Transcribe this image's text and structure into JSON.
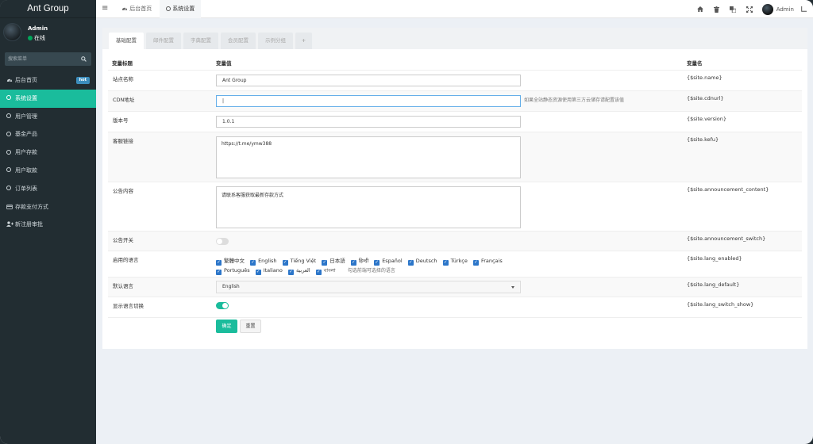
{
  "brand": "Ant Group",
  "user": {
    "name": "Admin",
    "status": "在线"
  },
  "search": {
    "placeholder": "搜索菜单"
  },
  "menu": [
    {
      "label": "后台首页",
      "icon": "dashboard-icon",
      "badge": "hot"
    },
    {
      "label": "系统设置",
      "icon": "circle-icon",
      "active": true
    },
    {
      "label": "用户管理",
      "icon": "circle-icon"
    },
    {
      "label": "基金产品",
      "icon": "circle-icon"
    },
    {
      "label": "用户存款",
      "icon": "circle-icon"
    },
    {
      "label": "用户取款",
      "icon": "circle-icon"
    },
    {
      "label": "订单列表",
      "icon": "circle-icon"
    },
    {
      "label": "存款支付方式",
      "icon": "credit-card-icon"
    },
    {
      "label": "新注册审批",
      "icon": "user-plus-icon"
    }
  ],
  "topbar": {
    "tabs": [
      {
        "label": "后台首页",
        "icon": "dashboard-icon"
      },
      {
        "label": "系统设置",
        "icon": "circle-icon",
        "active": true
      }
    ],
    "username": "Admin",
    "icons": [
      "home-icon",
      "trash-icon",
      "translate-icon",
      "fullscreen-icon"
    ]
  },
  "config_tabs": [
    "基础配置",
    "邮件配置",
    "字典配置",
    "会员配置",
    "示例分组",
    "+"
  ],
  "table": {
    "headers": {
      "title": "变量标题",
      "value": "变量值",
      "name": "变量名"
    },
    "rows": {
      "site_name": {
        "label": "站点名称",
        "value": "Ant Group",
        "var": "{$site.name}"
      },
      "cdn": {
        "label": "CDN地址",
        "value": "|",
        "hint": "如果全站静态资源使用第三方云储存请配置该值",
        "var": "{$site.cdnurl}"
      },
      "version": {
        "label": "版本号",
        "value": "1.0.1",
        "var": "{$site.version}"
      },
      "kefu": {
        "label": "客服链接",
        "value": "https://t.me/ymw388",
        "var": "{$site.kefu}"
      },
      "announcement": {
        "label": "公告内容",
        "value": "请联系客服获取最新存款方式",
        "var": "{$site.announcement_content}"
      },
      "announcement_switch": {
        "label": "公告开关",
        "on": false,
        "var": "{$site.announcement_switch}"
      },
      "langs": {
        "label": "启用的语言",
        "options": [
          "繁體中文",
          "English",
          "Tiếng Việt",
          "日本語",
          "हिन्दी",
          "Español",
          "Deutsch",
          "Türkçe",
          "Français",
          "Português",
          "Italiano",
          "العربية",
          "বাংলা"
        ],
        "hint": "勾选前端可选择的语言",
        "var": "{$site.lang_enabled}"
      },
      "lang_default": {
        "label": "默认语言",
        "value": "English",
        "var": "{$site.lang_default}"
      },
      "lang_switch": {
        "label": "显示语言切换",
        "on": true,
        "var": "{$site.lang_switch_show}"
      }
    }
  },
  "buttons": {
    "submit": "确定",
    "reset": "重置"
  },
  "colors": {
    "sidebar": "#222d32",
    "accent": "#1abc9c",
    "checkbox": "#2c76c9",
    "page_bg": "#ecf0f5"
  }
}
